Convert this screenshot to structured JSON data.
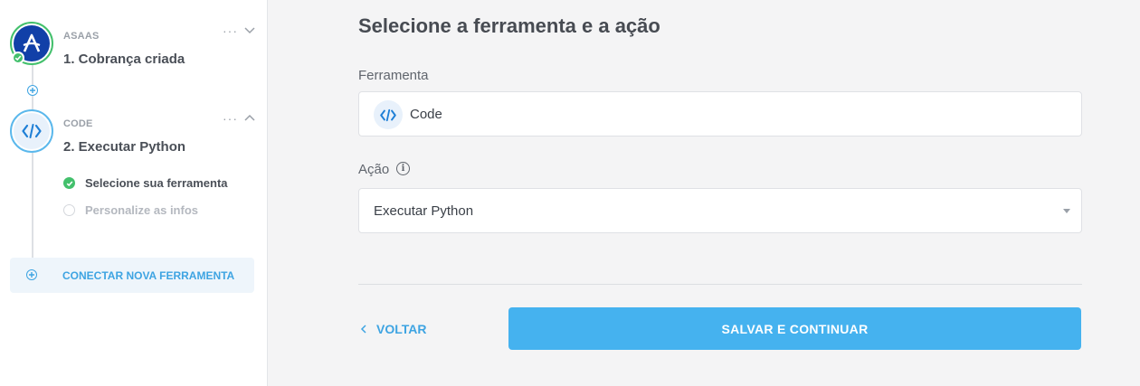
{
  "sidebar": {
    "steps": [
      {
        "app": "ASAAS",
        "title": "1. Cobrança criada",
        "icon": "asaas-logo-icon",
        "status": "complete",
        "more": "···"
      },
      {
        "app": "CODE",
        "title": "2. Executar Python",
        "icon": "code-icon",
        "status": "active",
        "more": "···"
      }
    ],
    "sub_steps": [
      {
        "label": "Selecione sua ferramenta",
        "status": "done"
      },
      {
        "label": "Personalize as infos",
        "status": "pending"
      }
    ],
    "connect_label": "CONECTAR NOVA FERRAMENTA"
  },
  "main": {
    "title": "Selecione a ferramenta e a ação",
    "tool_label": "Ferramenta",
    "tool_value": "Code",
    "action_label": "Ação",
    "action_value": "Executar Python",
    "back_label": "VOLTAR",
    "save_label": "SALVAR E CONTINUAR"
  },
  "colors": {
    "accent": "#45b2ef",
    "link": "#3ea4e2",
    "success": "#43c06c",
    "asaas_brand": "#1140a8"
  }
}
